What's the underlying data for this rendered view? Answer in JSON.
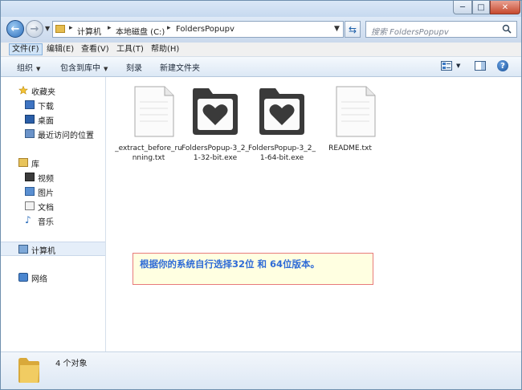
{
  "window": {
    "buttons": {
      "minimize": "─",
      "maximize": "□",
      "close": "✕"
    }
  },
  "address": {
    "crumbs": [
      "计算机",
      "本地磁盘 (C:)",
      "FoldersPopupv"
    ],
    "search_placeholder": "搜索 FoldersPopupv"
  },
  "menu": {
    "items": [
      "文件(F)",
      "编辑(E)",
      "查看(V)",
      "工具(T)",
      "帮助(H)"
    ]
  },
  "toolbar": {
    "organize": "组织",
    "include_library": "包含到库中",
    "burn": "刻录",
    "new_folder": "新建文件夹",
    "help": "?"
  },
  "sidebar": {
    "favorites": "收藏夹",
    "favorites_items": [
      "下载",
      "桌面",
      "最近访问的位置"
    ],
    "libraries": "库",
    "library_items": [
      "视频",
      "图片",
      "文档",
      "音乐"
    ],
    "computer": "计算机",
    "network": "网络"
  },
  "files": [
    {
      "name": "_extract_before_running.txt",
      "type": "text"
    },
    {
      "name": "FoldersPopup-3_2_1-32-bit.exe",
      "type": "app"
    },
    {
      "name": "FoldersPopup-3_2_1-64-bit.exe",
      "type": "app"
    },
    {
      "name": "README.txt",
      "type": "text"
    }
  ],
  "notice": "根据你的系统自行选择32位 和 64位版本。",
  "status": "4 个对象",
  "colors": {
    "accent": "#2e6bd6",
    "notice_border": "#e77b7b",
    "notice_bg": "#ffffe1"
  }
}
